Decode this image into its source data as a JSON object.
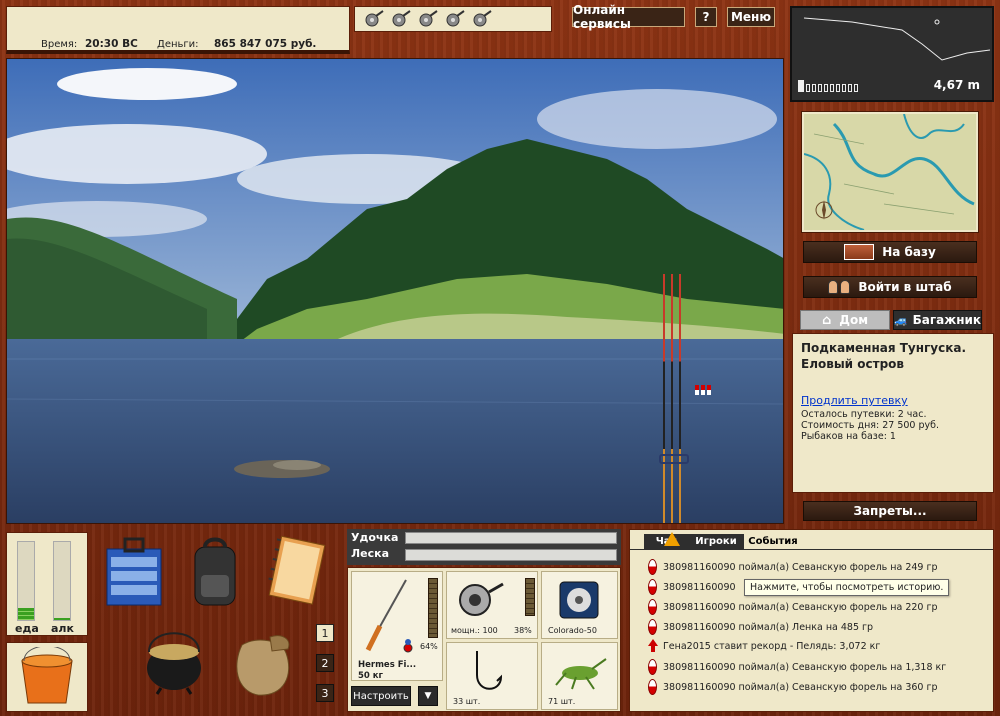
{
  "status": {
    "time_label": "Время:",
    "time_value": "20:30 ВС",
    "money_label": "Деньги:",
    "money_value": "865 847 075 руб."
  },
  "topbar": {
    "online_services": "Онлайн сервисы",
    "help": "?",
    "menu": "Меню",
    "reel_icon_count": 5
  },
  "depth": {
    "value": "4,67 m"
  },
  "nav": {
    "to_base": "На базу",
    "headquarters": "Войти в штаб",
    "home_tab": "Дом",
    "trunk_tab": "Багажник",
    "bans": "Запреты..."
  },
  "location": {
    "name": "Подкаменная Тунгуска. Еловый остров",
    "extend_link": "Продлить путевку",
    "remaining": "Осталось путевки: 2 час.",
    "day_cost": "Стоимость дня: 27 500 руб.",
    "fishers": "Рыбаков на базе: 1"
  },
  "needs": {
    "food_label": "еда",
    "alcohol_label": "алк",
    "food_level": 0.15,
    "alcohol_level": 0.02
  },
  "hotkeys": [
    "1",
    "2",
    "3"
  ],
  "tackle": {
    "rod_label": "Удочка",
    "line_label": "Леска",
    "rod_name": "Hermes Fi...",
    "rod_weight": "50 кг",
    "rod_percent": "64%",
    "reel_power": "мощн.: 100",
    "reel_percent": "38%",
    "line_name": "Colorado-50",
    "hook_count": "33 шт.",
    "bait_count": "71 шт.",
    "setup_button": "Настроить",
    "dropdown_arrow": "▼"
  },
  "events": {
    "tabs": [
      "Чат",
      "Игроки",
      "События"
    ],
    "tooltip": "Нажмите, чтобы посмотреть историю.",
    "rows": [
      {
        "text": "380981160090 поймал(а) Севанскую форель на 249 гр",
        "icon": "bobber"
      },
      {
        "text": "380981160090",
        "icon": "bobber"
      },
      {
        "text": "380981160090 поймал(а) Севанскую форель на 220 гр",
        "icon": "bobber"
      },
      {
        "text": "380981160090 поймал(а) Ленка на 485 гр",
        "icon": "bobber"
      },
      {
        "text": "Гена2015 ставит рекорд - Пелядь: 3,072 кг",
        "icon": "record"
      },
      {
        "text": "380981160090 поймал(а) Севанскую форель на 1,318 кг",
        "icon": "bobber"
      },
      {
        "text": "380981160090 поймал(а) Севанскую форель на 360 гр",
        "icon": "bobber"
      }
    ]
  },
  "colors": {
    "wood": "#7a2a10",
    "panel": "#efe8c9",
    "link": "#0033cc",
    "bobber_red": "#d40000"
  }
}
